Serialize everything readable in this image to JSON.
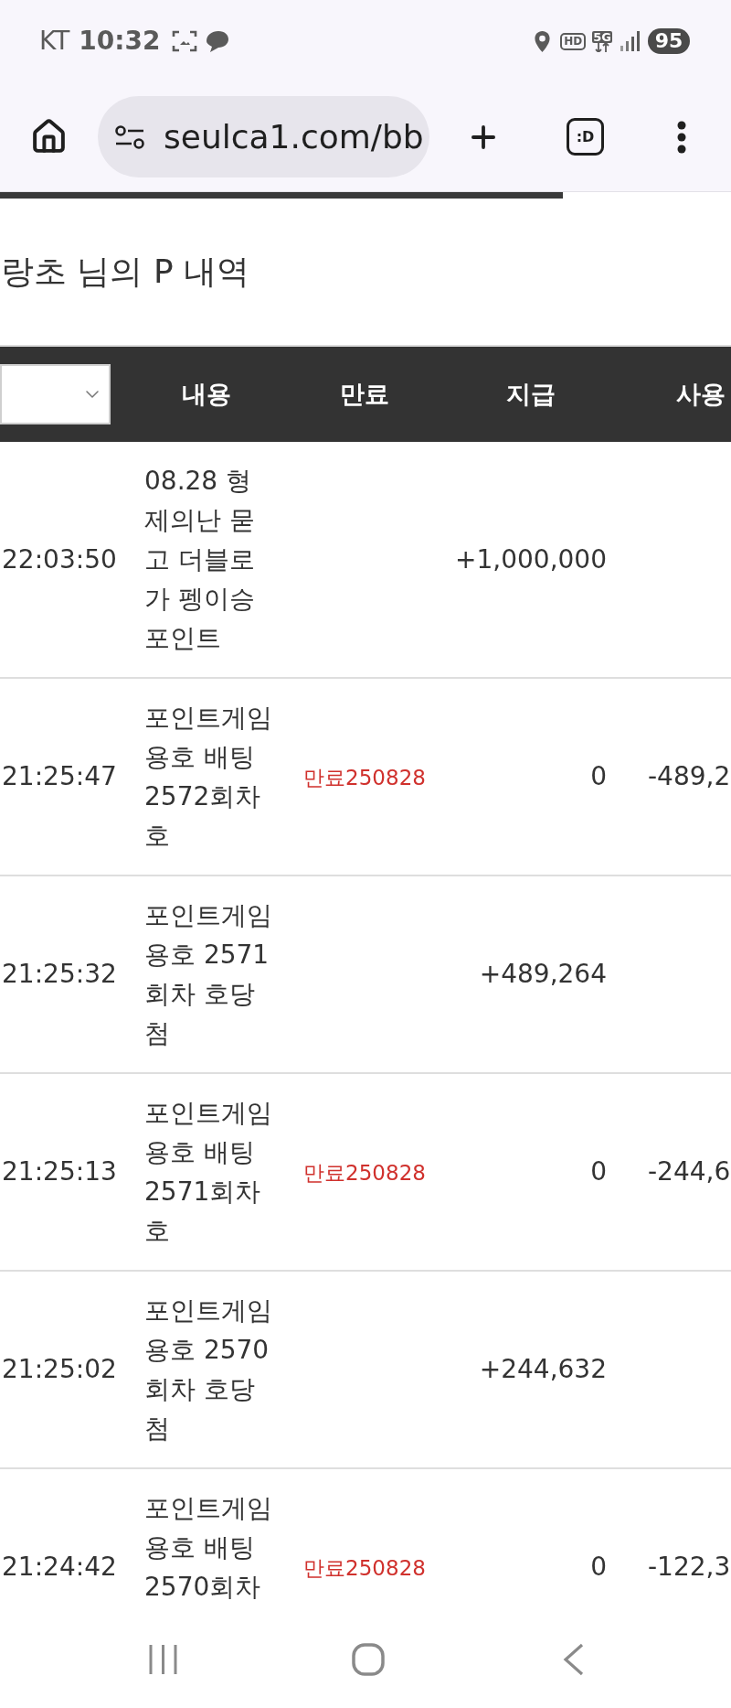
{
  "status_bar": {
    "carrier": "KT",
    "time": "10:32",
    "badges": [
      "HD",
      "5G"
    ],
    "battery": "95"
  },
  "browser": {
    "url": "seulca1.com/bb",
    "tab_switcher": ":D",
    "progress": {
      "level": 0.77
    }
  },
  "page": {
    "title": "랑초 님의 P 내역"
  },
  "table": {
    "columns": [
      "내용",
      "만료",
      "지급",
      "사용"
    ],
    "rows": [
      {
        "time": "22:03:50",
        "content": "08.28 형제의난 묻고 더블로 가 펭이승 포인트",
        "paid": "+1,000,000"
      },
      {
        "time": "21:25:47",
        "content": "포인트게임용호 배팅 2572회차 호",
        "expiry": "만료250828",
        "paid": "0",
        "used": "-489,2"
      },
      {
        "time": "21:25:32",
        "content": "포인트게임용호 2571회차 호당첨",
        "paid": "+489,264"
      },
      {
        "time": "21:25:13",
        "content": "포인트게임용호 배팅 2571회차 호",
        "expiry": "만료250828",
        "paid": "0",
        "used": "-244,6"
      },
      {
        "time": "21:25:02",
        "content": "포인트게임용호 2570회차 호당첨",
        "paid": "+244,632"
      },
      {
        "time": "21:24:42",
        "content": "포인트게임용호 배팅 2570회차",
        "expiry": "만료250828",
        "paid": "0",
        "used": "-122,3"
      }
    ]
  }
}
